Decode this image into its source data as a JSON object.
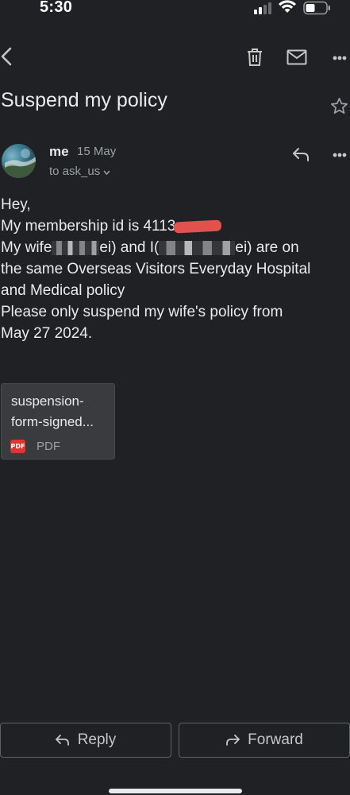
{
  "status_bar": {
    "time": "5:30"
  },
  "toolbar": {
    "icons": [
      "back-icon",
      "delete-icon",
      "mail-icon",
      "more-icon"
    ]
  },
  "email": {
    "subject": "Suspend my policy",
    "sender_name": "me",
    "date": "15 May",
    "recipient": "to ask_us",
    "body": {
      "greeting": "Hey,",
      "line2_prefix": "My membership id is 4113",
      "line3_a": "My wife",
      "line3_b": "ei) and I(",
      "line3_c": "ei)  are on",
      "line4": "the same Overseas Visitors Everyday Hospital",
      "line5": "and Medical policy",
      "line6": "Please only suspend my wife's policy from",
      "line7": "May 27 2024."
    },
    "attachment": {
      "name": "suspension-form-signed...",
      "type": "PDF",
      "badge": "PDF"
    }
  },
  "actions": {
    "reply_label": "Reply",
    "forward_label": "Forward"
  },
  "colors": {
    "background": "#202124",
    "text": "#e8eaed",
    "secondary": "#9aa0a6",
    "pdf_red": "#d33b2f"
  }
}
